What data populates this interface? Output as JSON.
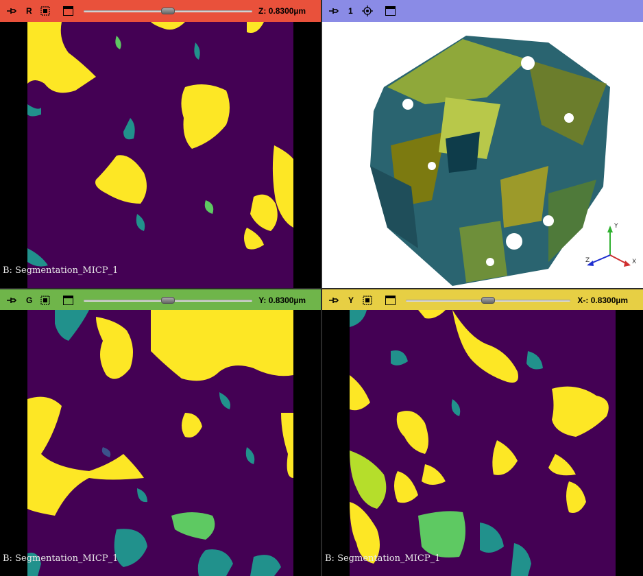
{
  "colors": {
    "red_bar": "#e9513b",
    "blue_bar": "#8a8be6",
    "green_bar": "#6fb54a",
    "yellow_bar": "#e7cf44",
    "viridis_dark": "#440154",
    "viridis_yellow": "#fde725",
    "viridis_teal": "#21918c",
    "viridis_green": "#5ec962"
  },
  "views": {
    "red": {
      "label": "R",
      "offset_text": "Z: 0.8300µm",
      "slider_fraction": 0.5,
      "corner_text": "B: Segmentation_MICP_1"
    },
    "three_d": {
      "label": "1",
      "axis_x": "X",
      "axis_y": "Y",
      "axis_z": "Z"
    },
    "green": {
      "label": "G",
      "offset_text": "Y: 0.8300µm",
      "slider_fraction": 0.5,
      "corner_text": "B: Segmentation_MICP_1"
    },
    "yellow": {
      "label": "Y",
      "offset_text": "X-: 0.8300µm",
      "slider_fraction": 0.5,
      "corner_text": "B: Segmentation_MICP_1"
    }
  },
  "icons": {
    "pin": "pin-icon",
    "link": "link-icon",
    "view_controller": "view-controller-icon",
    "center": "center-3d-icon"
  }
}
